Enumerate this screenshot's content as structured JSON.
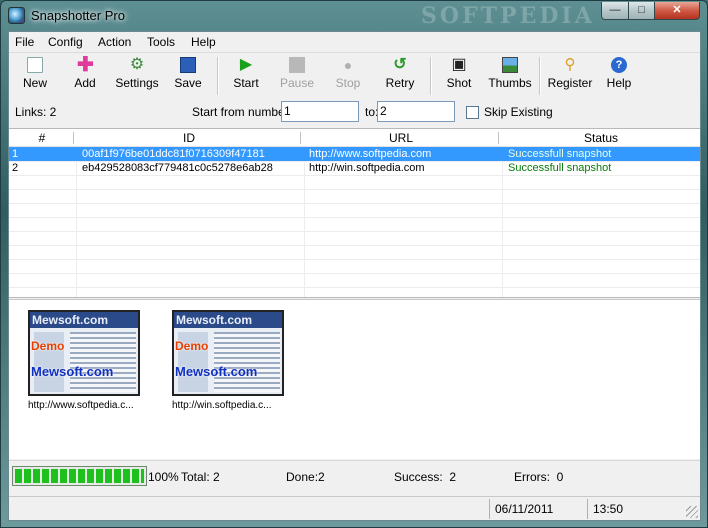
{
  "window": {
    "title": "Snapshotter Pro",
    "watermark": "SOFTPEDIA"
  },
  "menu": [
    "File",
    "Config",
    "Action",
    "Tools",
    "Help"
  ],
  "toolbar": [
    {
      "label": "New",
      "icon": "new-page-icon",
      "enabled": true
    },
    {
      "label": "Add",
      "icon": "plus-icon",
      "enabled": true
    },
    {
      "label": "Settings",
      "icon": "gear-icon",
      "enabled": true
    },
    {
      "label": "Save",
      "icon": "disk-icon",
      "enabled": true
    },
    {
      "label": "Start",
      "icon": "play-icon",
      "enabled": true
    },
    {
      "label": "Pause",
      "icon": "pause-icon",
      "enabled": false
    },
    {
      "label": "Stop",
      "icon": "stop-icon",
      "enabled": false
    },
    {
      "label": "Retry",
      "icon": "retry-icon",
      "enabled": true
    },
    {
      "label": "Shot",
      "icon": "camera-icon",
      "enabled": true
    },
    {
      "label": "Thumbs",
      "icon": "thumbnails-icon",
      "enabled": true
    },
    {
      "label": "Register",
      "icon": "key-icon",
      "enabled": true
    },
    {
      "label": "Help",
      "icon": "help-icon",
      "enabled": true
    }
  ],
  "links": {
    "label": "Links: 2",
    "start_label": "Start from number:",
    "from_value": "1",
    "to_label": "to:",
    "to_value": "2",
    "skip_label": "Skip Existing",
    "skip_checked": false
  },
  "table": {
    "columns": [
      "#",
      "ID",
      "URL",
      "Status"
    ],
    "rows": [
      {
        "num": "1",
        "id": "00af1f976be01ddc81f0716309f47181",
        "url": "http://www.softpedia.com",
        "status": "Successfull snapshot",
        "selected": true
      },
      {
        "num": "2",
        "id": "eb429528083cf779481c0c5278e6ab28",
        "url": "http://win.softpedia.com",
        "status": "Successfull snapshot",
        "selected": false
      }
    ]
  },
  "thumbnails": [
    {
      "caption": "http://www.softpedia.c...",
      "overlay_top": "Mewsoft.com",
      "overlay_demo": "Demo",
      "overlay_bottom": "Mewsoft.com"
    },
    {
      "caption": "http://win.softpedia.c...",
      "overlay_top": "Mewsoft.com",
      "overlay_demo": "Demo",
      "overlay_bottom": "Mewsoft.com"
    }
  ],
  "progress": {
    "fraction": 1.0,
    "percent_label": "100%",
    "total": "Total: 2",
    "done": "Done:2",
    "success": "Success:  2",
    "errors": "Errors:  0"
  },
  "statusbar": {
    "date": "06/11/2011",
    "time": "13:50"
  },
  "colors": {
    "selection": "#3399ff",
    "status_ok": "#0a7a0a",
    "progress": "#1ec01e"
  }
}
